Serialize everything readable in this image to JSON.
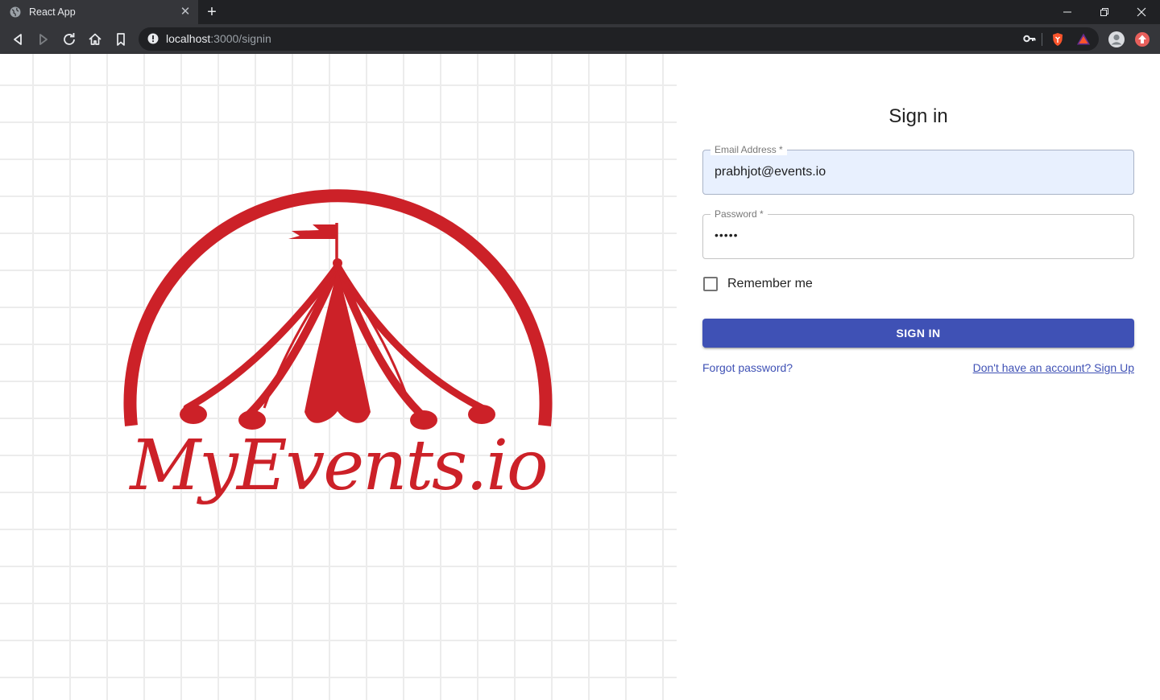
{
  "browser": {
    "tab_title": "React App",
    "url_host": "localhost",
    "url_path": ":3000/signin"
  },
  "hero": {
    "logo_text": "MyEvents.io",
    "brand_color": "#cc2128"
  },
  "form": {
    "title": "Sign in",
    "email_label": "Email Address *",
    "email_value": "prabhjot@events.io",
    "password_label": "Password *",
    "password_value": "•••••",
    "remember_label": "Remember me",
    "remember_checked": false,
    "submit_label": "Sign In",
    "forgot_link": "Forgot password?",
    "signup_link": "Don't have an account? Sign Up",
    "primary_color": "#3f51b5"
  }
}
